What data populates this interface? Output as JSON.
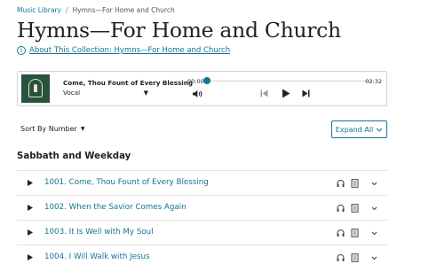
{
  "breadcrumb": {
    "root": "Music Library",
    "separator": "/",
    "current": "Hymns—For Home and Church"
  },
  "page": {
    "title": "Hymns—For Home and Church",
    "about_link": "About This Collection: Hymns—For Home and Church"
  },
  "player": {
    "song_title": "Come, Thou Fount of Every Blessing",
    "version": "Vocal",
    "time_current": "00:00",
    "time_total": "02:32",
    "progress": 0
  },
  "controls": {
    "sort_label": "Sort By Number",
    "expand_label": "Expand All"
  },
  "section": {
    "title": "Sabbath and Weekday"
  },
  "hymns": [
    {
      "title": "1001. Come, Thou Fount of Every Blessing"
    },
    {
      "title": "1002. When the Savior Comes Again"
    },
    {
      "title": "1003. It Is Well with My Soul"
    },
    {
      "title": "1004. I Will Walk with Jesus"
    }
  ],
  "colors": {
    "accent": "#157493",
    "artwork": "#28513e",
    "text": "#212225",
    "border": "#d3d3d3"
  },
  "icons": {
    "info": "info-icon",
    "play": "play-icon",
    "previous": "skip-previous-icon",
    "next": "skip-next-icon",
    "volume": "volume-icon",
    "headphones": "headphones-icon",
    "sheet_music": "sheet-music-icon",
    "chevron": "chevron-down-icon"
  }
}
